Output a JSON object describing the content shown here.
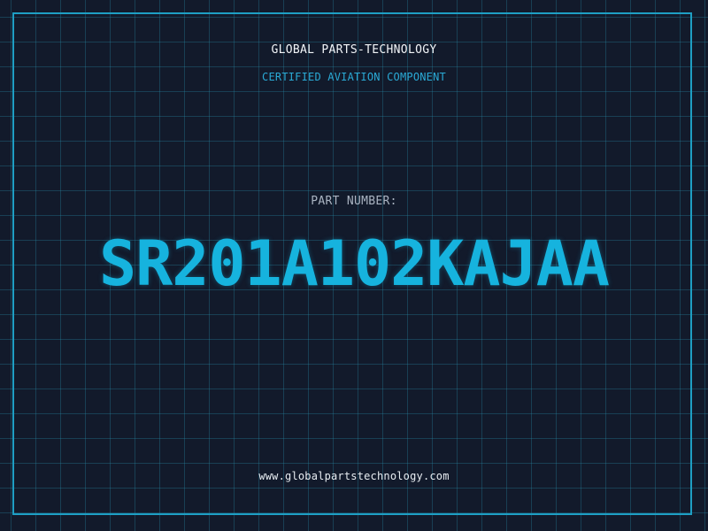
{
  "header": {
    "company": "GLOBAL PARTS-TECHNOLOGY",
    "subtitle": "CERTIFIED AVIATION COMPONENT"
  },
  "part": {
    "label": "PART NUMBER:",
    "number": "SR201A102KAJAA"
  },
  "footer": {
    "website": "www.globalpartstechnology.com"
  },
  "colors": {
    "background": "#121a2b",
    "grid": "#288caa",
    "frame": "#1e9fc4",
    "accent": "#16b3de",
    "text": "#f2f5f8",
    "muted": "#aab4c2"
  }
}
